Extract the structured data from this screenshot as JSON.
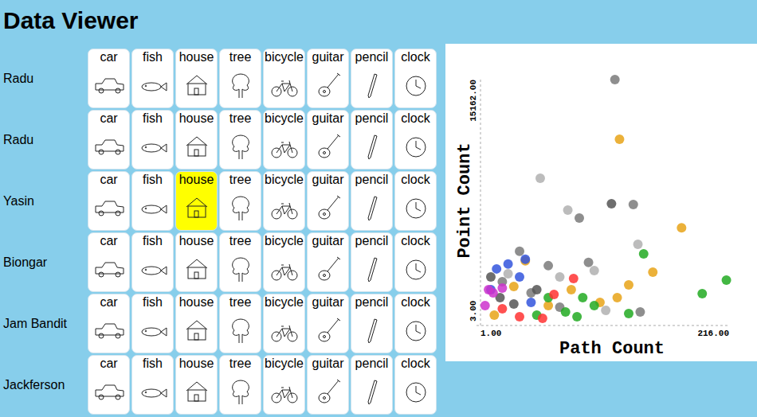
{
  "title": "Data Viewer",
  "rows": [
    {
      "name": "Radu",
      "samples": [
        {
          "label": "car",
          "selected": false
        },
        {
          "label": "fish",
          "selected": false
        },
        {
          "label": "house",
          "selected": false
        },
        {
          "label": "tree",
          "selected": false
        },
        {
          "label": "bicycle",
          "selected": false
        },
        {
          "label": "guitar",
          "selected": false
        },
        {
          "label": "pencil",
          "selected": false
        },
        {
          "label": "clock",
          "selected": false
        }
      ]
    },
    {
      "name": "Radu",
      "samples": [
        {
          "label": "car",
          "selected": false
        },
        {
          "label": "fish",
          "selected": false
        },
        {
          "label": "house",
          "selected": false
        },
        {
          "label": "tree",
          "selected": false
        },
        {
          "label": "bicycle",
          "selected": false
        },
        {
          "label": "guitar",
          "selected": false
        },
        {
          "label": "pencil",
          "selected": false
        },
        {
          "label": "clock",
          "selected": false
        }
      ]
    },
    {
      "name": "Yasin",
      "samples": [
        {
          "label": "car",
          "selected": false
        },
        {
          "label": "fish",
          "selected": false
        },
        {
          "label": "house",
          "selected": true
        },
        {
          "label": "tree",
          "selected": false
        },
        {
          "label": "bicycle",
          "selected": false
        },
        {
          "label": "guitar",
          "selected": false
        },
        {
          "label": "pencil",
          "selected": false
        },
        {
          "label": "clock",
          "selected": false
        }
      ]
    },
    {
      "name": "Biongar",
      "samples": [
        {
          "label": "car",
          "selected": false
        },
        {
          "label": "fish",
          "selected": false
        },
        {
          "label": "house",
          "selected": false
        },
        {
          "label": "tree",
          "selected": false
        },
        {
          "label": "bicycle",
          "selected": false
        },
        {
          "label": "guitar",
          "selected": false
        },
        {
          "label": "pencil",
          "selected": false
        },
        {
          "label": "clock",
          "selected": false
        }
      ]
    },
    {
      "name": "Jam Bandit",
      "samples": [
        {
          "label": "car",
          "selected": false
        },
        {
          "label": "fish",
          "selected": false
        },
        {
          "label": "house",
          "selected": false
        },
        {
          "label": "tree",
          "selected": false
        },
        {
          "label": "bicycle",
          "selected": false
        },
        {
          "label": "guitar",
          "selected": false
        },
        {
          "label": "pencil",
          "selected": false
        },
        {
          "label": "clock",
          "selected": false
        }
      ]
    },
    {
      "name": "Jackferson",
      "samples": [
        {
          "label": "car",
          "selected": false
        },
        {
          "label": "fish",
          "selected": false
        },
        {
          "label": "house",
          "selected": false
        },
        {
          "label": "tree",
          "selected": false
        },
        {
          "label": "bicycle",
          "selected": false
        },
        {
          "label": "guitar",
          "selected": false
        },
        {
          "label": "pencil",
          "selected": false
        },
        {
          "label": "clock",
          "selected": false
        }
      ]
    }
  ],
  "chart": {
    "x_axis": {
      "title": "Path Count",
      "ticks": [
        "1.00",
        "216.00"
      ]
    },
    "y_axis": {
      "title": "Point Count",
      "ticks": [
        "3.00",
        "15162.00"
      ]
    },
    "series": [
      {
        "color": "#7a7a7a",
        "points": [
          [
            118,
            15162
          ],
          [
            134,
            7330
          ],
          [
            87,
            6480
          ],
          [
            35,
            4400
          ],
          [
            60,
            3500
          ],
          [
            95,
            3700
          ],
          [
            20,
            2500
          ],
          [
            45,
            1800
          ],
          [
            140,
            600
          ],
          [
            70,
            900
          ]
        ]
      },
      {
        "color": "#e8a317",
        "points": [
          [
            122,
            11420
          ],
          [
            176,
            5880
          ],
          [
            151,
            3090
          ],
          [
            13,
            400
          ],
          [
            40,
            3800
          ],
          [
            30,
            2200
          ],
          [
            80,
            2000
          ],
          [
            105,
            1200
          ],
          [
            120,
            1500
          ],
          [
            130,
            2300
          ],
          [
            60,
            1000
          ]
        ]
      },
      {
        "color": "#b0b0b0",
        "points": [
          [
            53,
            8976
          ],
          [
            77,
            6980
          ],
          [
            138,
            4840
          ],
          [
            100,
            3200
          ],
          [
            70,
            2800
          ],
          [
            110,
            700
          ],
          [
            25,
            3000
          ]
        ]
      },
      {
        "color": "#555555",
        "points": [
          [
            115,
            7380
          ],
          [
            10,
            2800
          ],
          [
            18,
            1500
          ],
          [
            30,
            1100
          ],
          [
            50,
            2000
          ]
        ]
      },
      {
        "color": "#22aa22",
        "points": [
          [
            143,
            4240
          ],
          [
            194,
            1750
          ],
          [
            215,
            2600
          ],
          [
            90,
            1500
          ],
          [
            100,
            1000
          ],
          [
            75,
            600
          ],
          [
            85,
            300
          ],
          [
            60,
            1500
          ],
          [
            130,
            500
          ],
          [
            50,
            400
          ]
        ]
      },
      {
        "color": "#3355dd",
        "points": [
          [
            15,
            3300
          ],
          [
            25,
            3600
          ],
          [
            35,
            2800
          ],
          [
            40,
            3900
          ],
          [
            10,
            2000
          ],
          [
            45,
            1200
          ]
        ]
      },
      {
        "color": "#ff3333",
        "points": [
          [
            82,
            2700
          ],
          [
            20,
            800
          ],
          [
            35,
            300
          ],
          [
            55,
            200
          ],
          [
            65,
            1700
          ]
        ]
      },
      {
        "color": "#cc33cc",
        "points": [
          [
            8,
            2000
          ],
          [
            12,
            1800
          ],
          [
            20,
            2100
          ],
          [
            5,
            1000
          ]
        ]
      }
    ]
  }
}
